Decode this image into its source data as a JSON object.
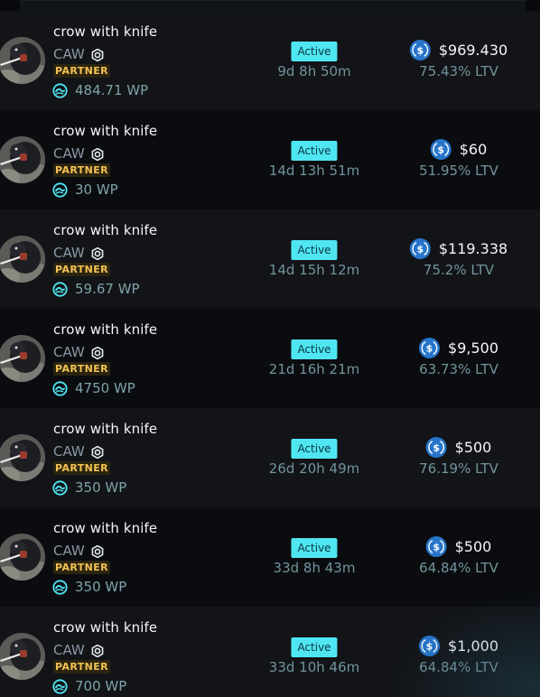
{
  "colors": {
    "accent_cyan": "#4fe6f2",
    "partner_gold": "#f3c152",
    "usdc_blue": "#2775ca"
  },
  "icons": {
    "verified": "verified-badge-icon",
    "wp": "wave-points-icon",
    "amount": "usdc-coin-icon"
  },
  "rows": [
    {
      "name": "crow with knife",
      "ticker": "CAW",
      "partner": "PARTNER",
      "wp": "484.71 WP",
      "status": "Active",
      "duration": "9d 8h 50m",
      "amount": "$969.430",
      "ltv": "75.43% LTV"
    },
    {
      "name": "crow with knife",
      "ticker": "CAW",
      "partner": "PARTNER",
      "wp": "30 WP",
      "status": "Active",
      "duration": "14d 13h 51m",
      "amount": "$60",
      "ltv": "51.95% LTV"
    },
    {
      "name": "crow with knife",
      "ticker": "CAW",
      "partner": "PARTNER",
      "wp": "59.67 WP",
      "status": "Active",
      "duration": "14d 15h 12m",
      "amount": "$119.338",
      "ltv": "75.2% LTV"
    },
    {
      "name": "crow with knife",
      "ticker": "CAW",
      "partner": "PARTNER",
      "wp": "4750 WP",
      "status": "Active",
      "duration": "21d 16h 21m",
      "amount": "$9,500",
      "ltv": "63.73% LTV"
    },
    {
      "name": "crow with knife",
      "ticker": "CAW",
      "partner": "PARTNER",
      "wp": "350 WP",
      "status": "Active",
      "duration": "26d 20h 49m",
      "amount": "$500",
      "ltv": "76.19% LTV"
    },
    {
      "name": "crow with knife",
      "ticker": "CAW",
      "partner": "PARTNER",
      "wp": "350 WP",
      "status": "Active",
      "duration": "33d 8h 43m",
      "amount": "$500",
      "ltv": "64.84% LTV"
    },
    {
      "name": "crow with knife",
      "ticker": "CAW",
      "partner": "PARTNER",
      "wp": "700 WP",
      "status": "Active",
      "duration": "33d 10h 46m",
      "amount": "$1,000",
      "ltv": "64.84% LTV"
    }
  ]
}
